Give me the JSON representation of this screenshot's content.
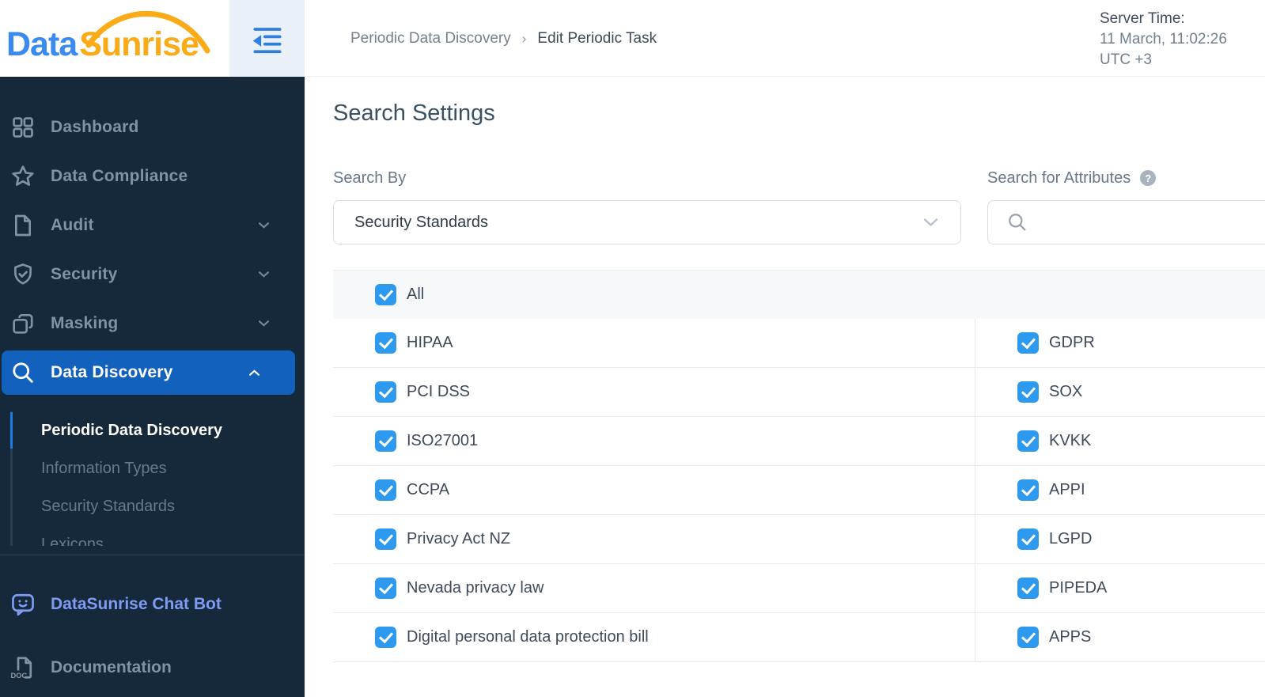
{
  "header": {
    "logo": {
      "part1": "Data",
      "part2": "Sunrise"
    },
    "breadcrumb": {
      "parent": "Periodic Data Discovery",
      "separator": "›",
      "current": "Edit Periodic Task"
    },
    "server_time": {
      "label": "Server Time:",
      "datetime": "11 March, 11:02:26",
      "timezone": "UTC +3"
    }
  },
  "sidebar": {
    "items": [
      {
        "label": "Dashboard",
        "icon": "grid-icon"
      },
      {
        "label": "Data Compliance",
        "icon": "star-icon"
      },
      {
        "label": "Audit",
        "icon": "document-icon",
        "chevron": "down"
      },
      {
        "label": "Security",
        "icon": "shield-check-icon",
        "chevron": "down"
      },
      {
        "label": "Masking",
        "icon": "copy-icon",
        "chevron": "down"
      },
      {
        "label": "Data Discovery",
        "icon": "search-icon",
        "chevron": "up",
        "active": true
      }
    ],
    "submenu": [
      {
        "label": "Periodic Data Discovery",
        "active": true
      },
      {
        "label": "Information Types"
      },
      {
        "label": "Security Standards"
      },
      {
        "label": "Lexicons",
        "clipped": true
      }
    ],
    "footer_items": [
      {
        "label": "DataSunrise Chat Bot",
        "icon": "chat-bot-icon"
      },
      {
        "label": "Documentation",
        "icon": "doc-file-icon",
        "icon_text": "DOC"
      }
    ]
  },
  "main": {
    "title": "Search Settings",
    "search_by": {
      "label": "Search By",
      "selected": "Security Standards"
    },
    "search_attributes": {
      "label": "Search for Attributes",
      "help_glyph": "?",
      "value": "",
      "placeholder": ""
    },
    "standards": {
      "select_all_label": "All",
      "all_checked": true,
      "left_column": [
        "HIPAA",
        "PCI DSS",
        "ISO27001",
        "CCPA",
        "Privacy Act NZ",
        "Nevada privacy law",
        "Digital personal data protection bill"
      ],
      "right_column": [
        "GDPR",
        "SOX",
        "KVKK",
        "APPI",
        "LGPD",
        "PIPEDA",
        "APPS"
      ]
    }
  },
  "colors": {
    "sidebar_bg": "#16293a",
    "active_item": "#1161bd",
    "checkbox_blue": "#2d9af0",
    "logo_blue": "#3a8af2",
    "logo_orange": "#fbab18",
    "chat_bot_accent": "#7e9cf4"
  }
}
